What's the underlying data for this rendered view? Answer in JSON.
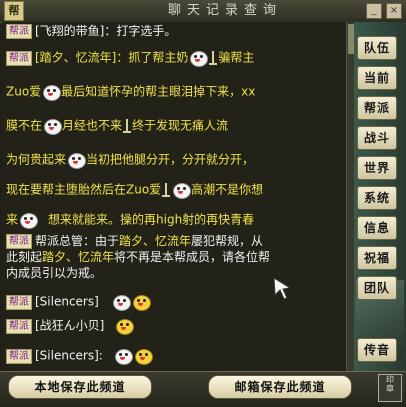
{
  "window": {
    "title": "聊天记录查询",
    "corner_label": "帮",
    "min_label": "_",
    "close_label": "×"
  },
  "chat": {
    "lines": [
      {
        "tag": "帮派",
        "text": "[飞翔的带鱼]：打字选手。",
        "color": "white"
      },
      {
        "tag": "帮派",
        "text": "[踏夕、忆流年]：抓了帮主奶",
        "text2": "骗帮主",
        "color": "yellow"
      },
      {
        "text": "Zuo爱",
        "text2": "最后知道怀孕的帮主眼泪掉下来，xx",
        "color": "yellow"
      },
      {
        "text": "膜不在",
        "text2": "月经也不来",
        "text3": "终于发现无痛人流",
        "color": "yellow"
      },
      {
        "text": "为何贵起来",
        "text2": "当初把他腿分开，分开就分开，",
        "color": "yellow"
      },
      {
        "text": "现在要帮主堕胎然后在Zuo爱",
        "text2": "高潮不是你想",
        "color": "yellow"
      },
      {
        "text": "来",
        "text2": "想来就能来。操的再high射的再快青春",
        "color": "yellow"
      },
      {
        "tag": "帮派",
        "text": "帮派总管：由于",
        "name": "踏夕、忆流年",
        "text2": "屡犯帮规，从",
        "color": "white"
      },
      {
        "text": "此刻起",
        "name": "踏夕、忆流年",
        "text2": "将不再是本帮成员，请各位帮",
        "color": "white"
      },
      {
        "text": "内成员引以为戒。",
        "color": "white"
      },
      {
        "tag": "帮派",
        "text": "[Silencers]",
        "color": "white"
      },
      {
        "tag": "帮派",
        "text": "[战狂ん小贝]",
        "color": "white"
      },
      {
        "tag": "帮派",
        "text": "[Silencers]:",
        "color": "white"
      }
    ]
  },
  "side_tabs": [
    "队伍",
    "当前",
    "帮派",
    "战斗",
    "世界",
    "系统",
    "信息",
    "祝福",
    "团队",
    "传音"
  ],
  "bottom": {
    "save_local": "本地保存此频道",
    "save_mail": "邮箱保存此频道"
  },
  "colors": {
    "tag_bg": "#e6dfb0",
    "tag_text": "#7a1a8a",
    "chat_yellow": "#f0e24a",
    "chat_white": "#f2f2f2",
    "chat_purple": "#d4a0ff"
  }
}
